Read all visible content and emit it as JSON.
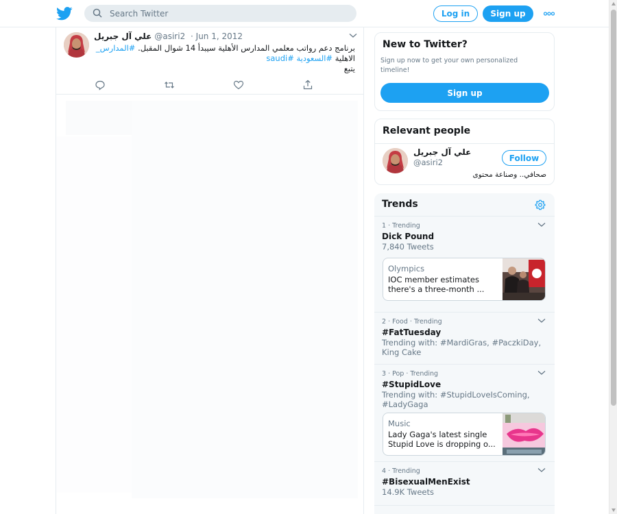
{
  "header": {
    "search_placeholder": "Search Twitter",
    "login_label": "Log in",
    "signup_label": "Sign up"
  },
  "tweet": {
    "name": "علي آل جبريل",
    "handle": "@asiri2",
    "date": "· Jun 1, 2012",
    "text_main": "برنامج دعم رواتب معلمي المدارس الأهلية سيبدأ 14 شوال المقبل. ",
    "hashtag1": "#المدارس_",
    "text_line2": "الاهلية ",
    "hashtag2": "#السعودية",
    "hashtag3": "#saudi",
    "text_line3": "يتبع"
  },
  "new_to_twitter": {
    "title": "New to Twitter?",
    "description": "Sign up now to get your own personalized timeline!",
    "button": "Sign up"
  },
  "relevant_people": {
    "title": "Relevant people",
    "name": "علي آل جبريل",
    "handle": "@asiri2",
    "follow": "Follow",
    "bio": "صحافي.. وصناعة محتوى"
  },
  "trends": {
    "title": "Trends",
    "items": [
      {
        "meta": "1 · Trending",
        "name": "Dick Pound",
        "sub": "7,840 Tweets",
        "news": {
          "category": "Olympics",
          "text": "IOC member estimates there's a three-month ..."
        }
      },
      {
        "meta": "2 · Food · Trending",
        "name": "#FatTuesday",
        "sub": "Trending with: #MardiGras, #PaczkiDay, King Cake"
      },
      {
        "meta": "3 · Pop · Trending",
        "name": "#StupidLove",
        "sub": "Trending with: #StupidLoveIsComing, #LadyGaga",
        "news": {
          "category": "Music",
          "text": "Lady Gaga's latest single Stupid Love is dropping o..."
        }
      },
      {
        "meta": "4 · Trending",
        "name": "#BisexualMenExist",
        "sub": "14.9K Tweets"
      }
    ]
  },
  "colors": {
    "accent": "#1da1f2",
    "text_secondary": "#657786",
    "border": "#e6ecf0",
    "trends_bg": "#f5f8fa"
  }
}
